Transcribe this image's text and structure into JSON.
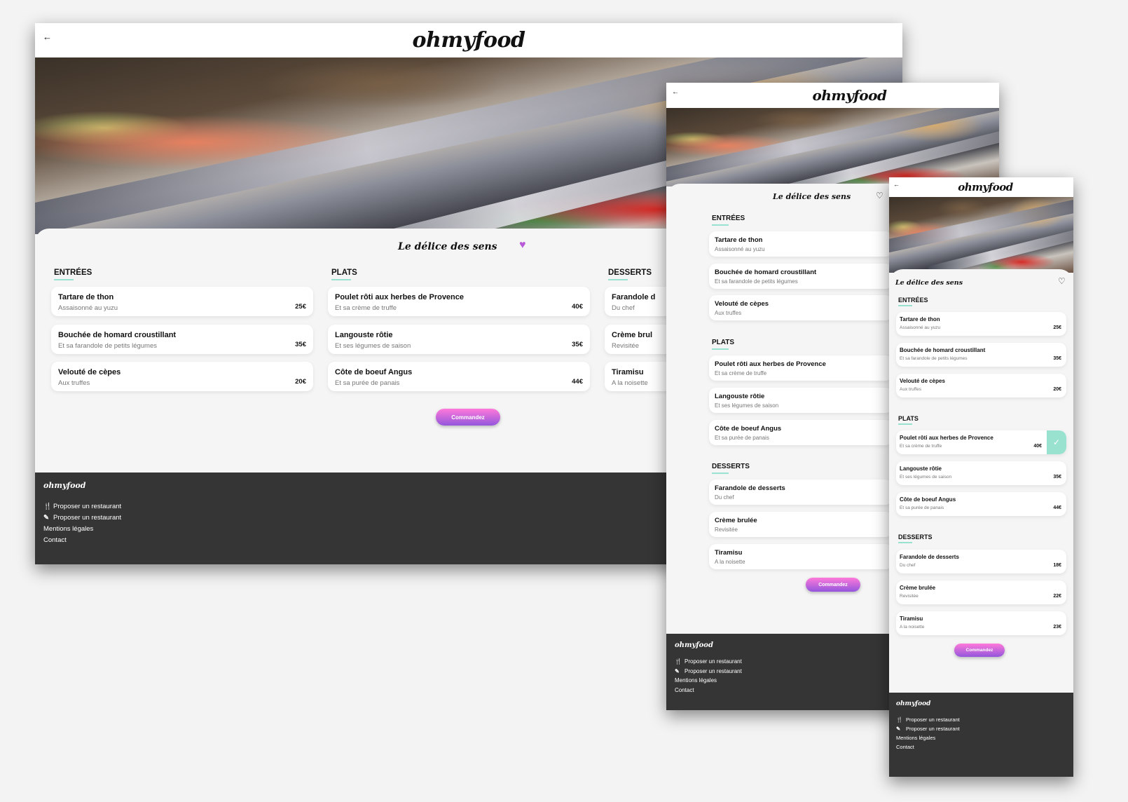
{
  "brand": {
    "logo": "ohmyfood",
    "back_icon": "←"
  },
  "menu": {
    "title": "Le délice des sens",
    "favorite_icon": "♥",
    "favorite_icon_outline": "♡",
    "order_label": "Commandez",
    "sections": [
      {
        "title": "ENTRÉES",
        "dishes": [
          {
            "name": "Tartare de thon",
            "desc": "Assaisonné au yuzu",
            "price": "25€"
          },
          {
            "name": "Bouchée de homard croustillant",
            "desc": "Et sa farandole de petits légumes",
            "price": "35€"
          },
          {
            "name": "Velouté de cèpes",
            "desc": "Aux truffes",
            "price": "20€"
          }
        ]
      },
      {
        "title": "PLATS",
        "dishes": [
          {
            "name": "Poulet rôti aux herbes de Provence",
            "desc": "Et sa crème de truffe",
            "price": "40€"
          },
          {
            "name": "Langouste rôtie",
            "desc": "Et ses légumes de saison",
            "price": "35€"
          },
          {
            "name": "Côte de boeuf Angus",
            "desc": "Et sa purée de panais",
            "price": "44€"
          }
        ]
      },
      {
        "title": "DESSERTS",
        "dishes": [
          {
            "name": "Farandole de desserts",
            "desc": "Du chef",
            "price": "18€"
          },
          {
            "name": "Crème brulée",
            "desc": "Revisitée",
            "price": "22€"
          },
          {
            "name": "Tiramisu",
            "desc": "A la noisette",
            "price": "23€"
          }
        ]
      }
    ],
    "desktop_clipped": {
      "section_title": "DESSERTS",
      "names": [
        "Farandole d",
        "Crème brul",
        "Tiramisu"
      ],
      "descs": [
        "Du chef",
        "Revisitée",
        "A la noisette"
      ]
    },
    "mobile_brulee": "Crème brulée"
  },
  "footer": {
    "logo": "ohmyfood",
    "links": [
      {
        "icon": "🍴",
        "label": "Proposer un restaurant"
      },
      {
        "icon": "✎",
        "label": "Proposer un restaurant"
      },
      {
        "icon": "",
        "label": "Mentions légales"
      },
      {
        "icon": "",
        "label": "Contact"
      }
    ]
  },
  "colors": {
    "accent": "#99e2d0",
    "button_top": "#ff79da",
    "button_bottom": "#9356dc",
    "footer": "#353535",
    "heart": "#b85ad8"
  }
}
